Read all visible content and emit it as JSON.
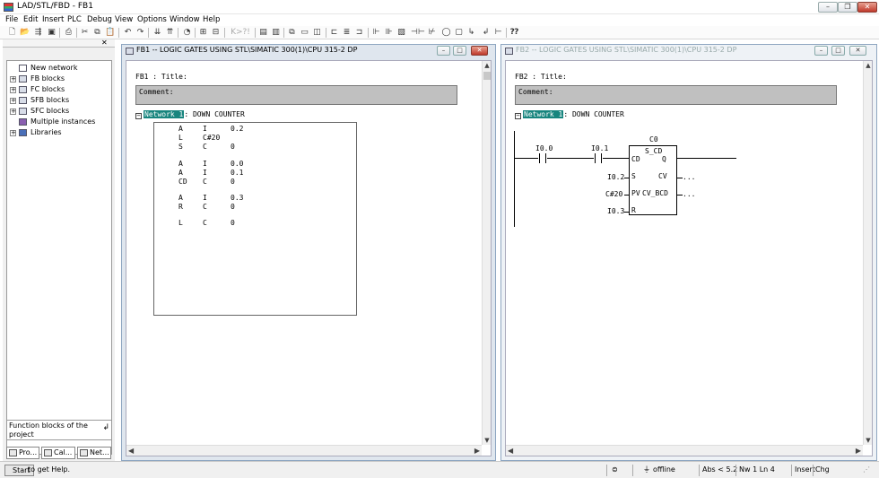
{
  "window": {
    "title": "LAD/STL/FBD  - FB1"
  },
  "menu": [
    "File",
    "Edit",
    "Insert",
    "PLC",
    "Debug",
    "View",
    "Options",
    "Window",
    "Help"
  ],
  "left_pane": {
    "tree": [
      {
        "label": "New network"
      },
      {
        "label": "FB blocks"
      },
      {
        "label": "FC blocks"
      },
      {
        "label": "SFB blocks"
      },
      {
        "label": "SFC blocks"
      },
      {
        "label": "Multiple instances"
      },
      {
        "label": "Libraries"
      }
    ],
    "status_text": "Function blocks of the project",
    "tabs": [
      {
        "label": "Pro..."
      },
      {
        "label": "Cal..."
      },
      {
        "label": "Net..."
      }
    ]
  },
  "editor1": {
    "title": "FB1 -- LOGIC GATES USING STL\\SIMATIC 300(1)\\CPU 315-2 DP",
    "fb_title": "FB1 : Title:",
    "comment": "Comment:",
    "network_label": "Network 1",
    "network_title": ": DOWN COUNTER",
    "stl": [
      {
        "op": "A",
        "type": "I",
        "addr": "0.2"
      },
      {
        "op": "L",
        "type": "C#20",
        "addr": ""
      },
      {
        "op": "S",
        "type": "C",
        "addr": "0"
      },
      {
        "op": "A",
        "type": "I",
        "addr": "0.0"
      },
      {
        "op": "A",
        "type": "I",
        "addr": "0.1"
      },
      {
        "op": "CD",
        "type": "C",
        "addr": "0"
      },
      {
        "op": "A",
        "type": "I",
        "addr": "0.3"
      },
      {
        "op": "R",
        "type": "C",
        "addr": "0"
      },
      {
        "op": "L",
        "type": "C",
        "addr": "0"
      }
    ]
  },
  "editor2": {
    "title": "FB2 -- LOGIC GATES USING STL\\SIMATIC 300(1)\\CPU 315-2 DP",
    "fb_title": "FB2 : Title:",
    "comment": "Comment:",
    "network_label": "Network 1",
    "network_title": ": DOWN COUNTER",
    "ladder": {
      "contact1": "I0.0",
      "contact2": "I0.1",
      "counter_name": "C0",
      "block_type": "S_CD",
      "pin_cd": "CD",
      "pin_q": "Q",
      "pin_s": "S",
      "pin_cv": "CV",
      "pin_pv": "PV",
      "pin_cvbcd": "CV_BCD",
      "pin_r": "R",
      "in_s": "I0.2",
      "in_pv": "C#20",
      "in_r": "I0.3",
      "out_cv": "...",
      "out_cvbcd": "..."
    }
  },
  "statusbar": {
    "start": "Start",
    "help": "to get Help.",
    "mode": "offline",
    "abs": "Abs < 5.2",
    "position": "Nw 1  Ln 4",
    "insert": "Insert",
    "chg": "Chg"
  }
}
